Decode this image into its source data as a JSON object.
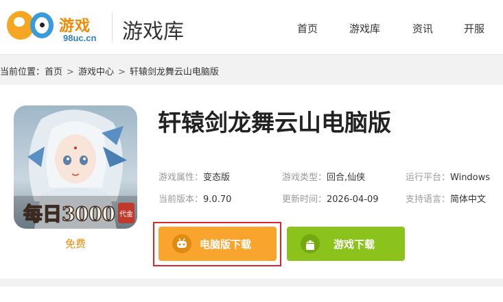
{
  "logo": {
    "brand_text": "游戏",
    "domain_text": "98uc.cn"
  },
  "header": {
    "site_title": "游戏库",
    "nav": [
      "首页",
      "游戏库",
      "资讯",
      "开服"
    ]
  },
  "breadcrumb": {
    "prefix": "当前位置：",
    "items": [
      "首页",
      "游戏中心",
      "轩辕剑龙舞云山电脑版"
    ],
    "separator": ">"
  },
  "game": {
    "title": "轩辕剑龙舞云山电脑版",
    "price": "免费",
    "icon_badge_text": "每日3000",
    "icon_badge_sub": "代金",
    "attributes": [
      {
        "key": "游戏属性：",
        "value": "变态版"
      },
      {
        "key": "游戏类型：",
        "value": "回合,仙侠"
      },
      {
        "key": "运行平台：",
        "value": "Windows"
      },
      {
        "key": "当前版本：",
        "value": "9.0.70"
      },
      {
        "key": "更新时间：",
        "value": "2026-04-09"
      },
      {
        "key": "支持语言：",
        "value": "简体中文"
      }
    ]
  },
  "buttons": {
    "pc_download": "电脑版下载",
    "game_download": "游戏下载"
  },
  "colors": {
    "accent_orange": "#f8a42d",
    "accent_green": "#8cc21c",
    "highlight_red": "#d9262c",
    "logo_blue": "#2f7fc8"
  }
}
